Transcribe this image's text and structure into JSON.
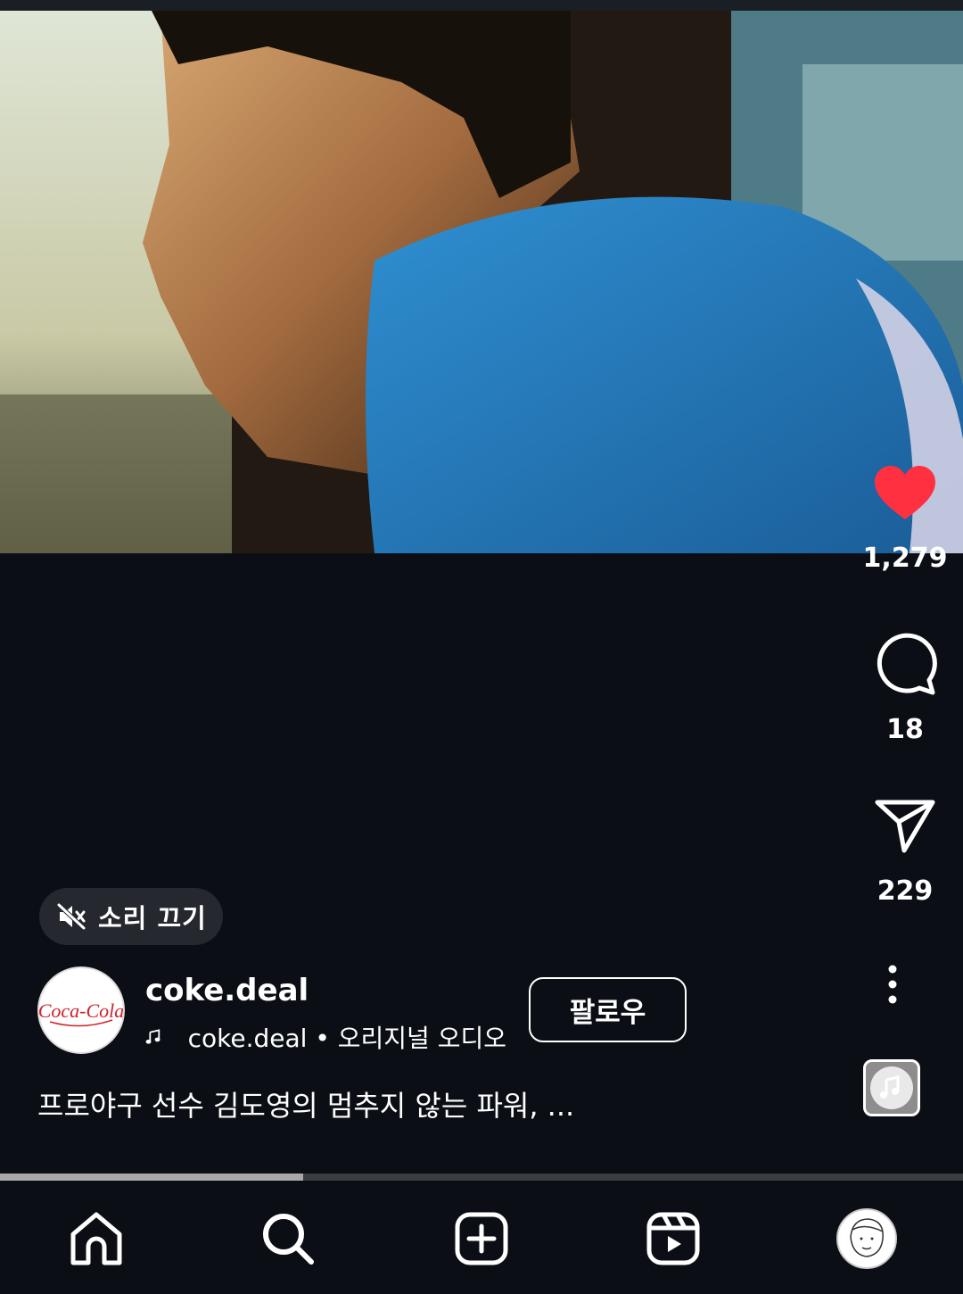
{
  "post": {
    "username": "coke.deal",
    "audio": "coke.deal • 오리지널 오디오",
    "follow_label": "팔로우",
    "caption": "프로야구 선수 김도영의 멈추지 않는 파워, ...",
    "avatar_logo": "Coca-Cola",
    "liked": true
  },
  "actions": {
    "likes": "1,279",
    "comments": "18",
    "shares": "229"
  },
  "mute": {
    "label": "소리 끄기",
    "icon": "speaker-muted-icon"
  },
  "playback": {
    "progress_fraction": 0.315
  },
  "colors": {
    "background": "#0b0f15",
    "like": "#ff3040",
    "text": "#ffffff"
  },
  "nav": {
    "items": [
      "home-icon",
      "search-icon",
      "create-icon",
      "reels-icon",
      "profile-avatar"
    ]
  }
}
